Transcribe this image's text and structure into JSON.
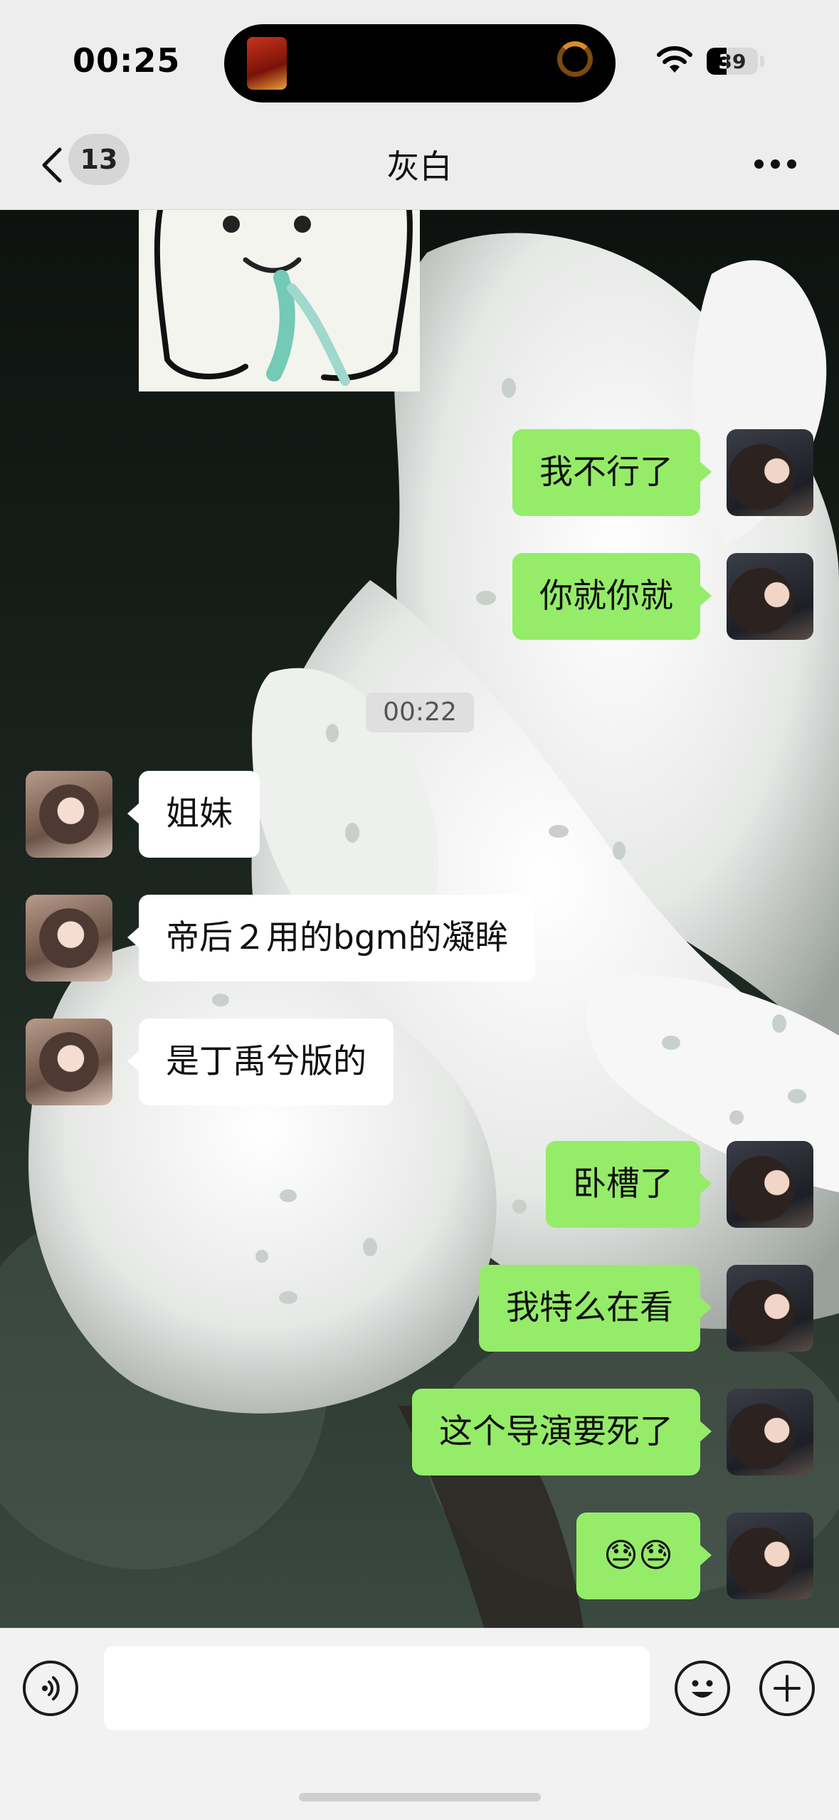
{
  "status_bar": {
    "time": "00:25",
    "battery": "39",
    "battery_level": 0.39
  },
  "nav": {
    "back_count": "13",
    "title": "灰白"
  },
  "chat": {
    "timestamp": "00:22",
    "messages": [
      {
        "sender": "me",
        "text": "我不行了"
      },
      {
        "sender": "me",
        "text": "你就你就"
      },
      {
        "sender": "other",
        "text": "姐妹"
      },
      {
        "sender": "other",
        "text": "帝后２用的bgm的凝眸"
      },
      {
        "sender": "other",
        "text": "是丁禹兮版的"
      },
      {
        "sender": "me",
        "text": "卧槽了"
      },
      {
        "sender": "me",
        "text": "我特么在看"
      },
      {
        "sender": "me",
        "text": "这个导演要死了"
      },
      {
        "sender": "me",
        "text": "😓😓"
      }
    ]
  },
  "input": {
    "value": "",
    "placeholder": ""
  },
  "colors": {
    "outgoing_bubble": "#95ec69",
    "incoming_bubble": "#ffffff",
    "bar_bg": "#ededed"
  },
  "icons": [
    "back-arrow-icon",
    "more-dots-icon",
    "voice-icon",
    "emoji-icon",
    "plus-icon",
    "wifi-icon",
    "battery-icon"
  ]
}
